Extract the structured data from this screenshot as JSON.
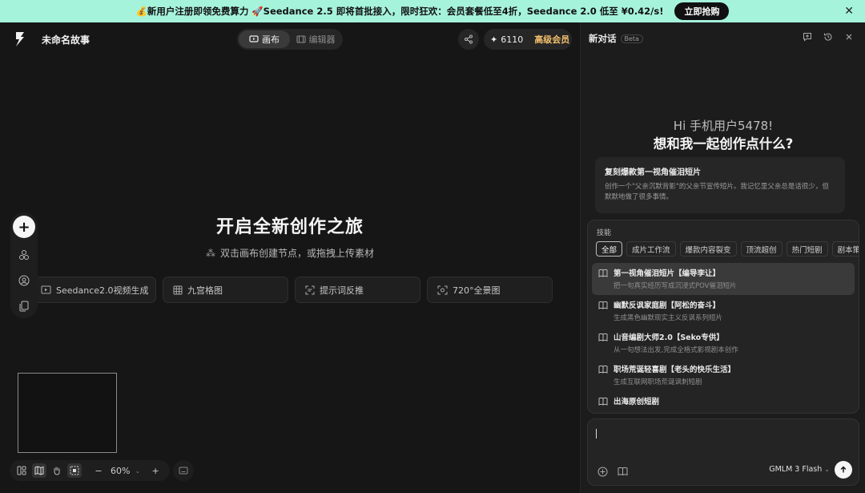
{
  "banner": {
    "text": "💰新用户注册即领免费算力 🚀Seedance 2.5 即将首批接入，限时狂欢：会员套餐低至4折，Seedance 2.0 低至 ¥0.42/s!",
    "cta": "立即抢购",
    "bg_color": "#a6f3dc"
  },
  "header": {
    "project_title": "未命名故事",
    "modes": [
      {
        "label": "画布",
        "icon": "canvas-icon",
        "active": true
      },
      {
        "label": "编辑器",
        "icon": "film-icon",
        "active": false
      }
    ],
    "credits": "6110",
    "vip_label": "高级会员",
    "vip_color": "#f2c06d"
  },
  "canvas": {
    "hero_title": "开启全新创作之旅",
    "hero_sub": "双击画布创建节点，或拖拽上传素材",
    "quick_actions": [
      {
        "label": "Seedance2.0视频生成",
        "icon": "video-icon"
      },
      {
        "label": "九宫格图",
        "icon": "grid-icon"
      },
      {
        "label": "提示词反推",
        "icon": "scan-text-icon"
      },
      {
        "label": "720°全景图",
        "icon": "panorama-icon"
      }
    ],
    "zoom": "60%"
  },
  "chat": {
    "title": "新对话",
    "badge": "Beta",
    "greeting": "Hi 手机用户5478!",
    "question": "想和我一起创作点什么?",
    "recommend": {
      "title": "复刻爆款第一视角催泪短片",
      "desc": "创作一个\"父亲沉默背影\"的父亲节宣传短片。我记忆里父亲总是话很少，但默默地做了很多事情。"
    },
    "skills_label": "技能",
    "filters": [
      "全部",
      "成片工作流",
      "爆款内容裂变",
      "顶流超创",
      "热门短剧",
      "剧本策划"
    ],
    "skills": [
      {
        "name": "第一视角催泪短片【编导李让】",
        "desc": "把一句真实经历写成沉浸式POV催泪短片",
        "active": true
      },
      {
        "name": "幽默反讽家庭剧【阿松的奋斗】",
        "desc": "生成黑色幽默现实主义反讽系列短片",
        "active": false
      },
      {
        "name": "山音编剧大师2.0【Seko专供】",
        "desc": "从一句想法出发,完成全格式影视剧本创作",
        "active": false
      },
      {
        "name": "职场荒诞轻喜剧【老头的快乐生活】",
        "desc": "生成互联网职场荒诞讽刺短剧",
        "active": false
      },
      {
        "name": "出海原创短剧",
        "desc": "",
        "active": false
      }
    ],
    "model": "GMLM 3 Flash"
  }
}
